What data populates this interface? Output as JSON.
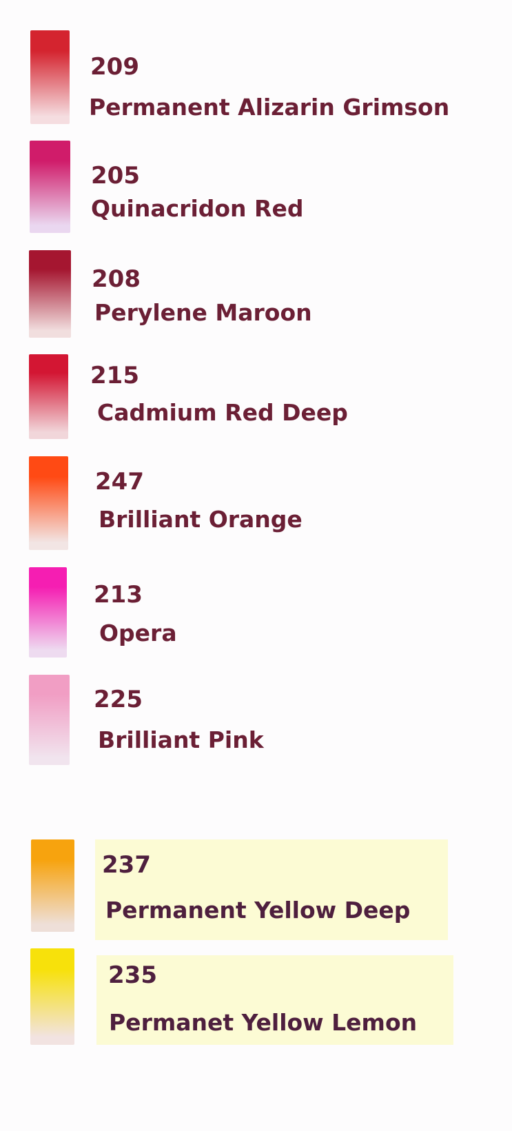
{
  "colors": [
    {
      "code": "209",
      "name": "Permanent Alizarin Grimson",
      "swatch_top": "#d4242f",
      "swatch_bottom": "#f5dde0"
    },
    {
      "code": "205",
      "name": "Quinacridon Red",
      "swatch_top": "#d01c6a",
      "swatch_bottom": "#ead7f0"
    },
    {
      "code": "208",
      "name": "Perylene Maroon",
      "swatch_top": "#a51630",
      "swatch_bottom": "#f1dede"
    },
    {
      "code": "215",
      "name": "Cadmium Red Deep",
      "swatch_top": "#d31633",
      "swatch_bottom": "#f1d6da"
    },
    {
      "code": "247",
      "name": "Brilliant Orange",
      "swatch_top": "#ff4a14",
      "swatch_bottom": "#f2e5e4"
    },
    {
      "code": "213",
      "name": "Opera",
      "swatch_top": "#f51eb2",
      "swatch_bottom": "#eedbf0"
    },
    {
      "code": "225",
      "name": "Brilliant Pink",
      "swatch_top": "#f19ec4",
      "swatch_bottom": "#f1e4ee"
    },
    {
      "code": "237",
      "name": "Permanent Yellow Deep",
      "swatch_top": "#f7a30e",
      "swatch_bottom": "#eedfd8"
    },
    {
      "code": "235",
      "name": "Permanet Yellow Lemon",
      "swatch_top": "#f7e10b",
      "swatch_bottom": "#f2e3e1"
    }
  ],
  "theme": {
    "text_color": "#6b1f35",
    "highlight_color": "#fcfbd4"
  }
}
